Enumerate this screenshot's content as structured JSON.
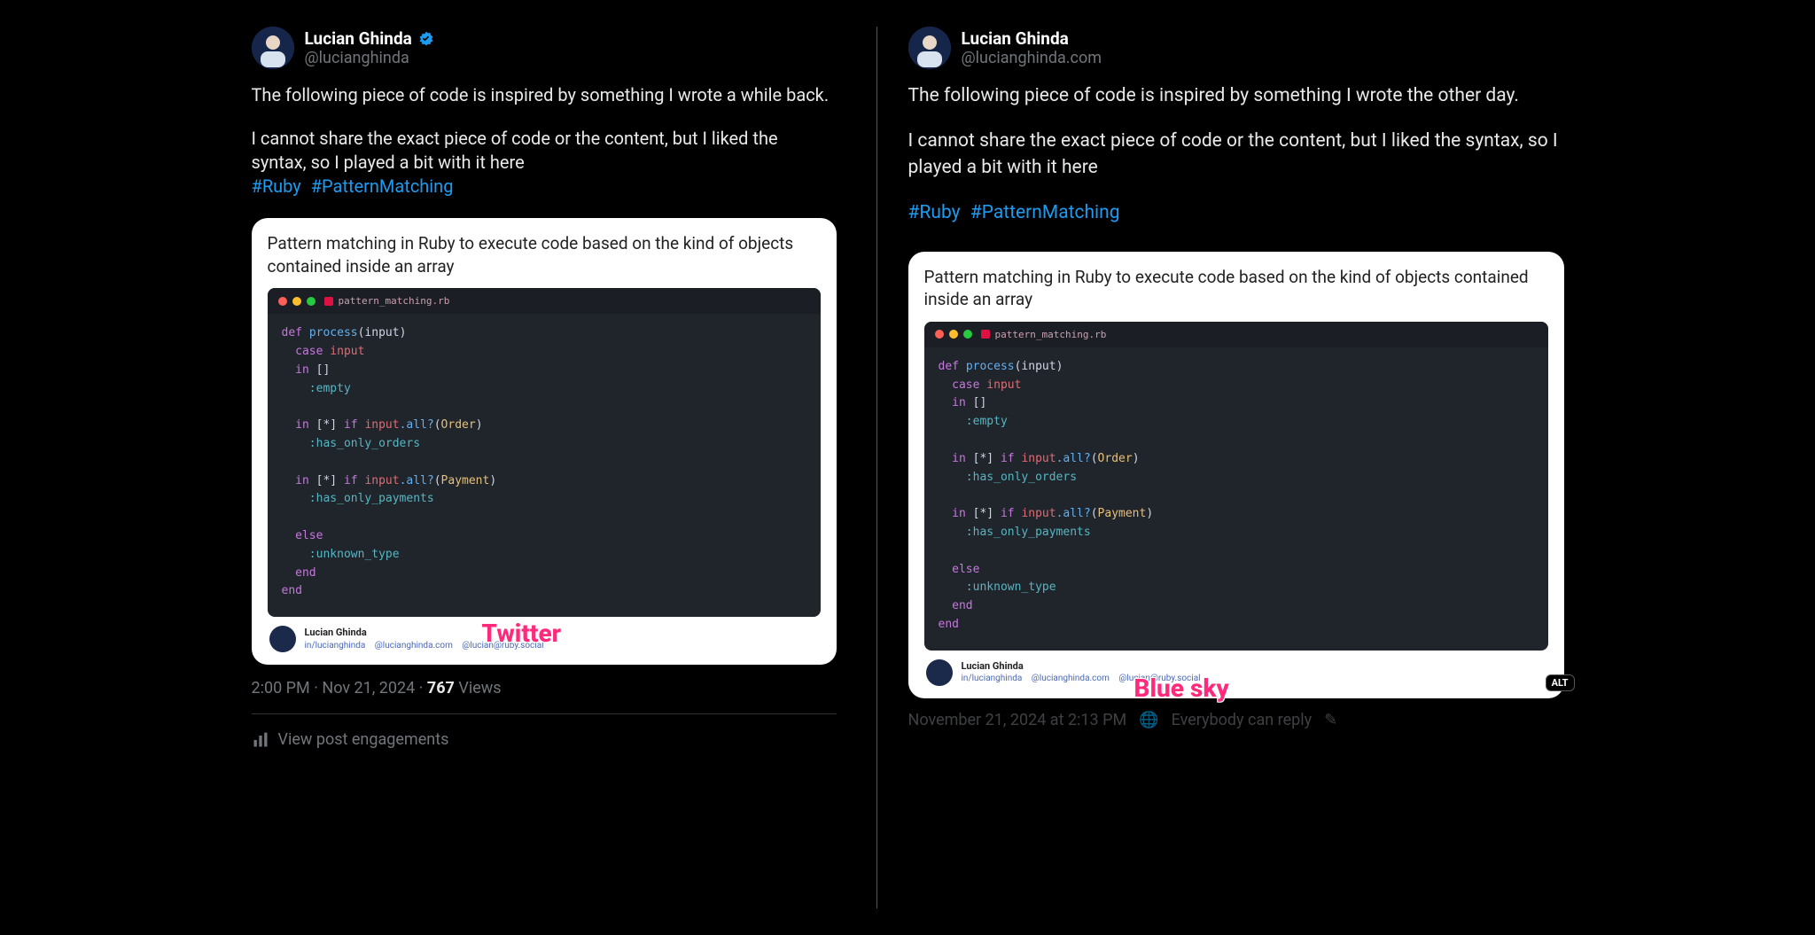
{
  "left": {
    "platform_label": "Twitter",
    "name": "Lucian Ghinda",
    "handle": "@lucianghinda",
    "verified": true,
    "para1": "The following piece of code is inspired by something I wrote a while back.",
    "para2": "I cannot share the exact piece of code or the content, but I liked the syntax, so I played a bit with it here",
    "hashtags": [
      "#Ruby",
      "#PatternMatching"
    ],
    "card_title": "Pattern matching in Ruby to execute code based on the kind of objects contained inside an array",
    "filename": "pattern_matching.rb",
    "code": {
      "l1_def": "def ",
      "l1_fn": "process",
      "l1_p": "(input)",
      "l2_case": "  case ",
      "l2_var": "input",
      "l3_in": "  in ",
      "l3_br": "[]",
      "l4_sym": "    :empty",
      "l5_blank": "",
      "l6_in": "  in ",
      "l6_br": "[*] ",
      "l6_if": "if ",
      "l6_var": "input",
      "l6_call": ".all?",
      "l6_p": "(",
      "l6_type": "Order",
      "l6_cp": ")",
      "l7_sym": "    :has_only_orders",
      "l8_blank": "",
      "l9_in": "  in ",
      "l9_br": "[*] ",
      "l9_if": "if ",
      "l9_var": "input",
      "l9_call": ".all?",
      "l9_p": "(",
      "l9_type": "Payment",
      "l9_cp": ")",
      "l10_sym": "    :has_only_payments",
      "l11_blank": "",
      "l12_else": "  else",
      "l13_sym": "    :unknown_type",
      "l14_end": "  end",
      "l15_end": "end"
    },
    "footer": {
      "name": "Lucian Ghinda",
      "links": [
        "in/lucianghinda",
        "@lucianghinda.com",
        "@lucian@ruby.social"
      ]
    },
    "time": "2:00 PM",
    "dot": " · ",
    "date": "Nov 21, 2024",
    "views_n": "767",
    "views_label": " Views",
    "engagements": "View post engagements"
  },
  "right": {
    "platform_label": "Blue sky",
    "name": "Lucian Ghinda",
    "handle": "@lucianghinda.com",
    "para1": "The following piece of code is inspired by something I wrote the other day.",
    "para2": "I cannot share the exact piece of code or the content, but I liked the syntax, so I played a bit with it here",
    "hashtags": [
      "#Ruby",
      "#PatternMatching"
    ],
    "card_title": "Pattern matching in Ruby to execute code based on the kind of objects contained inside an array",
    "filename": "pattern_matching.rb",
    "alt": "ALT",
    "footer": {
      "name": "Lucian Ghinda",
      "links": [
        "in/lucianghinda",
        "@lucianghinda.com",
        "@lucian@ruby.social"
      ]
    },
    "meta_date": "November 21, 2024 at 2:13 PM",
    "meta_reply": "Everybody can reply",
    "meta_icon": "✎"
  }
}
